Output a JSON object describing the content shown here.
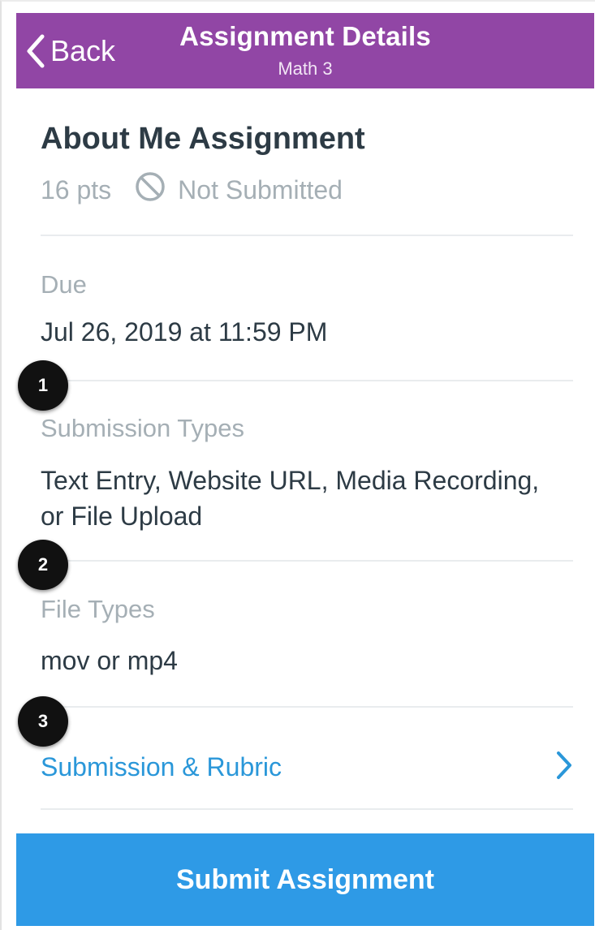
{
  "navbar": {
    "back_label": "Back",
    "title": "Assignment Details",
    "subtitle": "Math 3",
    "color": "#9146a5"
  },
  "assignment": {
    "name": "About Me Assignment",
    "points": "16 pts",
    "status": "Not Submitted",
    "status_icon": "not-submitted-icon"
  },
  "sections": {
    "due": {
      "label": "Due",
      "value": "Jul 26, 2019 at 11:59 PM"
    },
    "submission_types": {
      "label": "Submission Types",
      "value": "Text Entry, Website URL, Media Recording, or File Upload"
    },
    "file_types": {
      "label": "File Types",
      "value": "mov or mp4"
    }
  },
  "link": {
    "label": "Submission & Rubric",
    "icon": "chevron-right-icon",
    "color": "#2a97d9"
  },
  "badges": [
    "1",
    "2",
    "3"
  ],
  "submit": {
    "label": "Submit Assignment",
    "color": "#2e9ae6"
  }
}
